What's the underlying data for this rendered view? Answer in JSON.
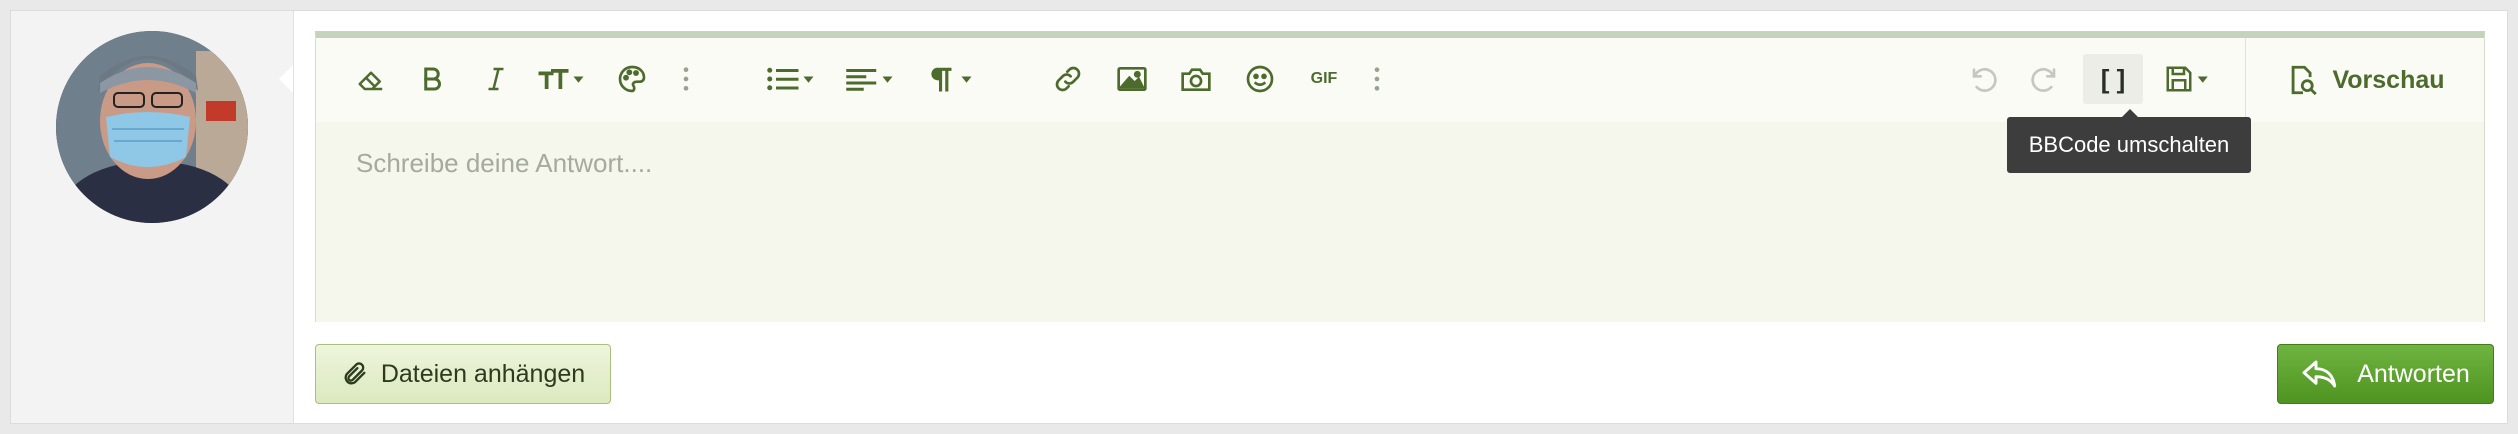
{
  "avatar": {
    "alt": "user avatar"
  },
  "toolbar": {
    "groups": [
      [
        "eraser-icon",
        "bold-icon",
        "italic-icon",
        "text-size-icon",
        "palette-icon",
        "more-vertical-icon"
      ],
      [
        "list-icon",
        "align-icon",
        "paragraph-icon"
      ],
      [
        "link-icon",
        "image-icon",
        "camera-icon",
        "smiley-icon",
        "gif-icon",
        "more-vertical-icon"
      ],
      [
        "undo-icon",
        "redo-icon",
        "bbcode-icon",
        "save-draft-icon"
      ]
    ],
    "gif_label": "GIF",
    "bbcode_label": "[ ]",
    "preview_label": "Vorschau"
  },
  "editor": {
    "placeholder": "Schreibe deine Antwort...."
  },
  "tooltip": {
    "text": "BBCode umschalten"
  },
  "actions": {
    "attach_label": "Dateien anhängen",
    "reply_label": "Antworten"
  },
  "colors": {
    "accent": "#4e6b2e",
    "editor_bg": "#f5f6ec",
    "reply_green": "#5ea32f",
    "attach_green": "#dbe9bf"
  }
}
